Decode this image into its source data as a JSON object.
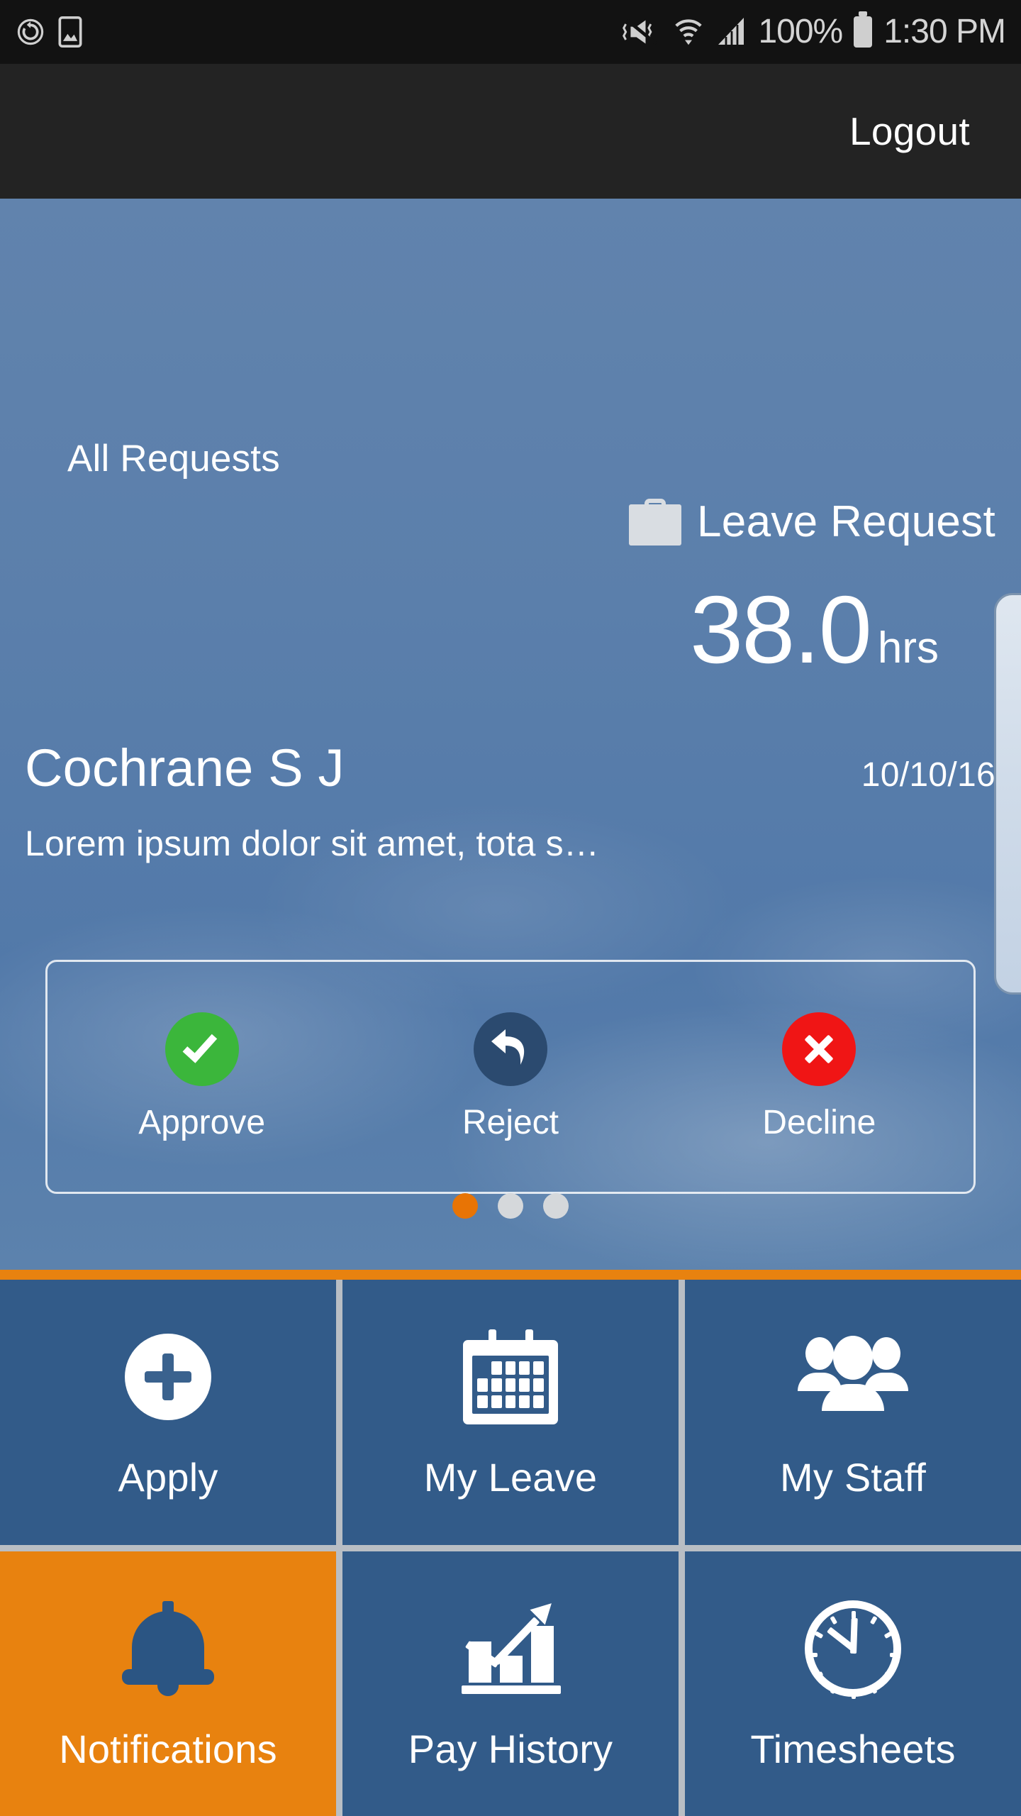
{
  "status_bar": {
    "left_icons": [
      "sync-icon",
      "screenshot-icon"
    ],
    "right_icons": [
      "vibrate-mute-icon",
      "wifi-icon",
      "signal-icon",
      "battery-icon"
    ],
    "battery_percent": "100%",
    "time": "1:30 PM"
  },
  "app_bar": {
    "logout_label": "Logout"
  },
  "hero": {
    "section_label": "All Requests",
    "request_type": "Leave Request",
    "type_icon": "briefcase-icon",
    "hours_value": "38.0",
    "hours_unit": "hrs",
    "employee_name": "Cochrane S J",
    "request_date": "10/10/16",
    "description": "Lorem ipsum dolor sit amet, tota s…"
  },
  "actions": [
    {
      "label": "Approve",
      "icon": "check-icon",
      "color": "#3bb63b"
    },
    {
      "label": "Reject",
      "icon": "undo-arrow-icon",
      "color": "#2b4a6f"
    },
    {
      "label": "Decline",
      "icon": "close-x-icon",
      "color": "#f01515"
    }
  ],
  "pager": {
    "total": 3,
    "active_index": 0,
    "active_color": "#e87405",
    "inactive_color": "#d5d8db"
  },
  "tiles": [
    {
      "label": "Apply",
      "icon": "plus-circle-icon",
      "accent": false
    },
    {
      "label": "My Leave",
      "icon": "calendar-icon",
      "accent": false
    },
    {
      "label": "My Staff",
      "icon": "people-group-icon",
      "accent": false
    },
    {
      "label": "Notifications",
      "icon": "bell-icon",
      "accent": true
    },
    {
      "label": "Pay History",
      "icon": "bar-chart-trend-icon",
      "accent": false
    },
    {
      "label": "Timesheets",
      "icon": "clock-icon",
      "accent": false
    }
  ],
  "colors": {
    "tile_blue": "#325b89",
    "accent_orange": "#e8820f",
    "hero_blue": "#5b7fab",
    "statusbar_black": "#121212",
    "appbar_black": "#232323"
  }
}
